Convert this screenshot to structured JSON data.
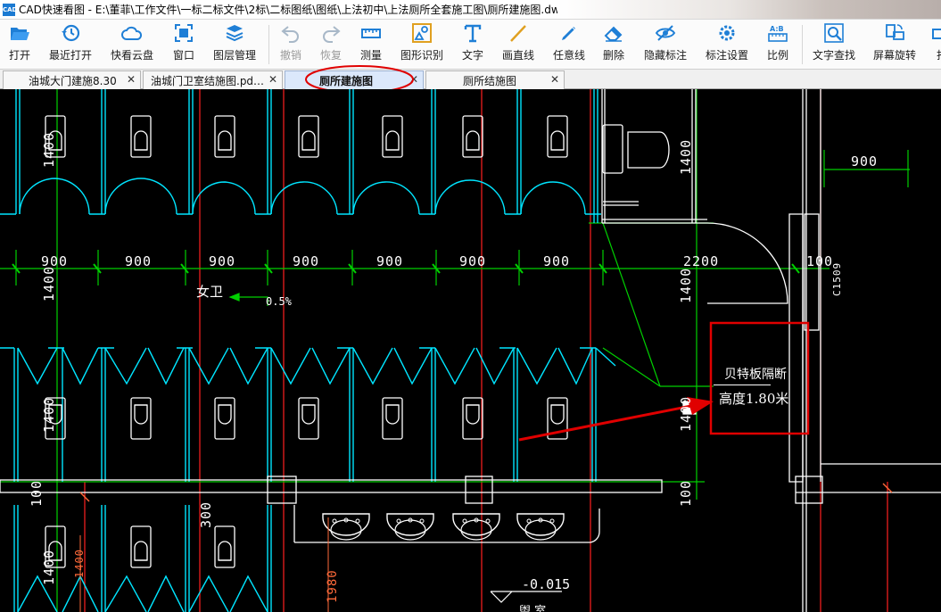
{
  "window": {
    "app_icon_text": "CAD",
    "title": "CAD快速看图 - E:\\董菲\\工作文件\\一标二标文件\\2标\\二标图纸\\图纸\\上法初中\\上法厕所全套施工图\\厕所建施图.dwg"
  },
  "toolbar": {
    "open": "打开",
    "recent": "最近打开",
    "cloud": "快看云盘",
    "window": "窗口",
    "layers": "图层管理",
    "undo": "撤销",
    "redo": "恢复",
    "measure": "测量",
    "shape_recog": "图形识别",
    "text": "文字",
    "line": "画直线",
    "freeline": "任意线",
    "delete": "删除",
    "hide_annot": "隐藏标注",
    "annot_settings": "标注设置",
    "scale": "比例",
    "text_search": "文字查找",
    "rotate": "屏幕旋转",
    "more": "打"
  },
  "tabs": [
    {
      "label": "油城大门建施8.30",
      "active": false
    },
    {
      "label": "油城门卫室结施图.pd…",
      "active": false
    },
    {
      "label": "厕所建施图",
      "active": true
    },
    {
      "label": "厕所结施图",
      "active": false
    }
  ],
  "drawing": {
    "dims_horizontal": [
      "900",
      "900",
      "900",
      "900",
      "900",
      "900",
      "900",
      "2200",
      "100"
    ],
    "dim_top_right": "900",
    "dims_vertical": {
      "upper_left": "1400",
      "mid_left": "1400",
      "lower_left": "1400",
      "bottom_left": "1400",
      "right_upper": "1400",
      "right_mid": "1400",
      "right_lower": "1400",
      "left_100": "100",
      "right_100": "100",
      "small_300": "300",
      "red_1400": "1400",
      "red_1980": "1980",
      "door_c1509": "C1509"
    },
    "room_label": "女卫",
    "slope": "0.5%",
    "elevation": "-0.015",
    "bottom_label": "盥 室",
    "annotation": {
      "line1": "贝特板隔断",
      "line2": "高度1.80米"
    }
  },
  "colors": {
    "cad_bg": "#000000",
    "cyan": "#00e5ff",
    "green": "#00d000",
    "red_axis": "#ff2020",
    "white": "#ffffff",
    "annotation_red": "#e00000",
    "active_tab": "#dbe8fb"
  }
}
